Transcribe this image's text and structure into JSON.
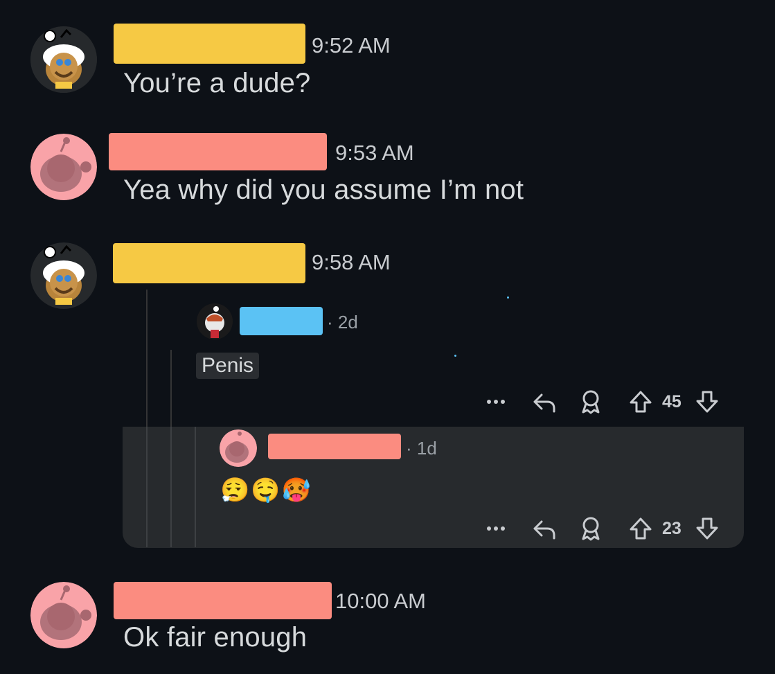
{
  "messages": [
    {
      "time": "9:52 AM",
      "text": "You’re a dude?"
    },
    {
      "time": "9:53 AM",
      "text": "Yea why did you assume I’m not"
    },
    {
      "time": "9:58 AM"
    },
    {
      "time": "10:00 AM",
      "text": "Ok fair enough"
    }
  ],
  "shared_comment": {
    "age": "· 2d",
    "text": "Penis",
    "votes": "45",
    "reply": {
      "age": "· 1d",
      "emojis": "😮‍💨🤤🥵",
      "votes": "23"
    }
  },
  "colors": {
    "redact_yellow": "#f6c944",
    "redact_pink": "#fb8c80",
    "redact_blue": "#5bc2f4",
    "background": "#0d1117",
    "reply_panel": "#272a2d"
  }
}
